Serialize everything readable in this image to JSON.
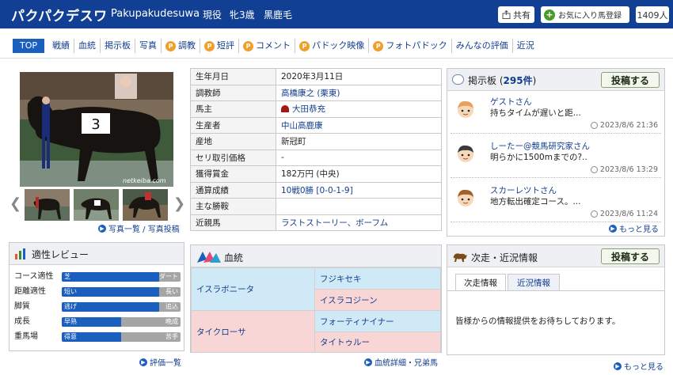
{
  "header": {
    "horse_name": "パクパクデスワ",
    "roman_name": "Pakupakudesuwa",
    "status": "現役",
    "sex_age": "牝3歳",
    "coat": "黒鹿毛",
    "share_label": "共有",
    "favorite_label": "お気に入り馬登録",
    "favorite_count": "1409人"
  },
  "tabs": [
    {
      "label": "TOP",
      "premium": false
    },
    {
      "label": "戦績",
      "premium": false
    },
    {
      "label": "血統",
      "premium": false
    },
    {
      "label": "掲示板",
      "premium": false
    },
    {
      "label": "写真",
      "premium": false
    },
    {
      "label": "調教",
      "premium": true
    },
    {
      "label": "短評",
      "premium": true
    },
    {
      "label": "コメント",
      "premium": true
    },
    {
      "label": "パドック映像",
      "premium": true
    },
    {
      "label": "フォトパドック",
      "premium": true
    },
    {
      "label": "みんなの評価",
      "premium": false
    },
    {
      "label": "近況",
      "premium": false
    }
  ],
  "premium_badge": "P",
  "photo": {
    "watermark": "netkeiba.com",
    "number_cloth": "3",
    "links_label": "写真一覧 / 写真投稿"
  },
  "info": [
    {
      "key": "生年月日",
      "value": "2020年3月11日",
      "link": false
    },
    {
      "key": "調教師",
      "value": "高橋康之 (栗東)",
      "link": true
    },
    {
      "key": "馬主",
      "value": "大田恭充",
      "link": true
    },
    {
      "key": "生産者",
      "value": "中山高鹿康",
      "link": true
    },
    {
      "key": "産地",
      "value": "新冠町",
      "link": false
    },
    {
      "key": "セリ取引価格",
      "value": "-",
      "link": false
    },
    {
      "key": "獲得賞金",
      "value": "182万円 (中央)",
      "link": false
    },
    {
      "key": "通算成績",
      "value": "10戦0勝 [0-0-1-9]",
      "link": true
    },
    {
      "key": "主な勝鞍",
      "value": "",
      "link": false
    },
    {
      "key": "近親馬",
      "value": "ラストストーリー、ボーフム",
      "link": true
    }
  ],
  "bbs": {
    "title": "掲示板",
    "count": "295件",
    "post_label": "投稿する",
    "posts": [
      {
        "user": "ゲストさん",
        "text": "持ちタイムが遅いと距...",
        "time": "2023/8/6 21:36"
      },
      {
        "user": "しーたー@競馬研究家さん",
        "text": "明らかに1500mまでの?..",
        "time": "2023/8/6 13:29"
      },
      {
        "user": "スカーレツトさん",
        "text": "地方転出確定コース。...",
        "time": "2023/8/6 11:24"
      }
    ],
    "more_label": "もっと見る"
  },
  "aptitude": {
    "title": "適性レビュー",
    "rows": [
      {
        "label": "コース適性",
        "left": "芝",
        "right": "ダート",
        "value": 0.82
      },
      {
        "label": "距離適性",
        "left": "短い",
        "right": "長い",
        "value": 0.82
      },
      {
        "label": "脚質",
        "left": "逃げ",
        "right": "追込",
        "value": 0.82
      },
      {
        "label": "成長",
        "left": "早熟",
        "right": "晩成",
        "value": 0.5
      },
      {
        "label": "重馬場",
        "left": "得意",
        "right": "苦手",
        "value": 0.5
      }
    ],
    "more_label": "評価一覧"
  },
  "pedigree": {
    "title": "血統",
    "sire": "イスラボニータ",
    "sire_sire": "フジキセキ",
    "sire_dam": "イスラコジーン",
    "dam": "タイクローサ",
    "dam_sire": "フォーティナイナー",
    "dam_dam": "タイトゥルー",
    "more_label": "血統詳細・兄弟馬"
  },
  "next_race": {
    "title": "次走・近況情報",
    "post_label": "投稿する",
    "tab_active": "次走情報",
    "tab_other": "近況情報",
    "message": "皆様からの情報提供をお待ちしております。",
    "more_label": "もっと見る"
  },
  "colors": {
    "header_bg": "#113f93",
    "link": "#123d8c",
    "active_tab": "#1a5fbe",
    "premium": "#f0a02a",
    "male": "#cfe9f6",
    "female": "#f8d6d6"
  }
}
